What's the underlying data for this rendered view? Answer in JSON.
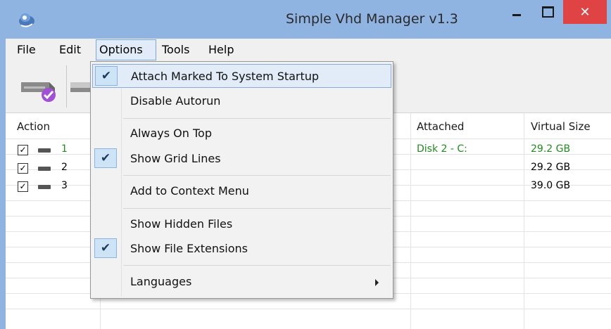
{
  "window": {
    "title": "Simple Vhd Manager v1.3",
    "close_glyph": "✕"
  },
  "menubar": {
    "items": [
      "File",
      "Edit",
      "Options",
      "Tools",
      "Help"
    ]
  },
  "toolbar": {
    "icons": [
      "disk-attach-icon",
      "disk-detach-icon"
    ]
  },
  "table": {
    "headers": {
      "action": "Action",
      "attached": "Attached",
      "virtual_size": "Virtual Size"
    },
    "rows": [
      {
        "checked": true,
        "number": "1",
        "attached": "Disk 2  -  C:",
        "virtual_size": "29.2 GB",
        "highlight": true
      },
      {
        "checked": true,
        "number": "2",
        "attached": "",
        "virtual_size": "29.2 GB",
        "highlight": false
      },
      {
        "checked": true,
        "number": "3",
        "attached": "",
        "virtual_size": "39.0 GB",
        "highlight": false
      }
    ]
  },
  "options_menu": {
    "check_glyph": "✔",
    "items": [
      {
        "label": "Attach Marked To System Startup",
        "checked": true,
        "highlighted": true
      },
      {
        "label": "Disable Autorun",
        "checked": false
      },
      {
        "label": "Always On Top",
        "checked": false
      },
      {
        "label": "Show Grid Lines",
        "checked": true
      },
      {
        "label": "Add to Context Menu",
        "checked": false
      },
      {
        "label": "Show Hidden Files",
        "checked": false
      },
      {
        "label": "Show File Extensions",
        "checked": true
      },
      {
        "label": "Languages",
        "checked": false,
        "submenu": true
      }
    ]
  },
  "colors": {
    "title_bar": "#8fb4e2",
    "close_button": "#e04343",
    "accent_green": "#1f8c1f",
    "menu_highlight": "#e1ecf8"
  }
}
